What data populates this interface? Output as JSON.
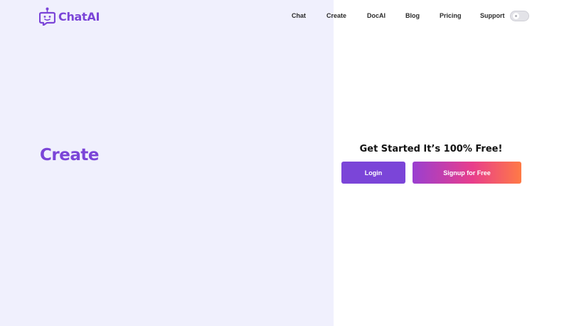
{
  "brand": {
    "name": "ChatAI",
    "icon": "robot-chat-icon",
    "color": "#7b45d8"
  },
  "nav": {
    "items": [
      "Chat",
      "Create",
      "DocAI",
      "Blog",
      "Pricing",
      "Support"
    ],
    "theme_toggle_icon": "theme-toggle-icon"
  },
  "hero": {
    "title": "Create"
  },
  "cta": {
    "heading": "Get Started It’s 100% Free!",
    "login_label": "Login",
    "signup_label": "Signup for Free"
  },
  "colors": {
    "left_panel_bg": "#f0f0fd",
    "primary": "#7b45d8",
    "gradient_start": "#9a3fd0",
    "gradient_mid": "#e83e8c",
    "gradient_end": "#ff7a45"
  }
}
